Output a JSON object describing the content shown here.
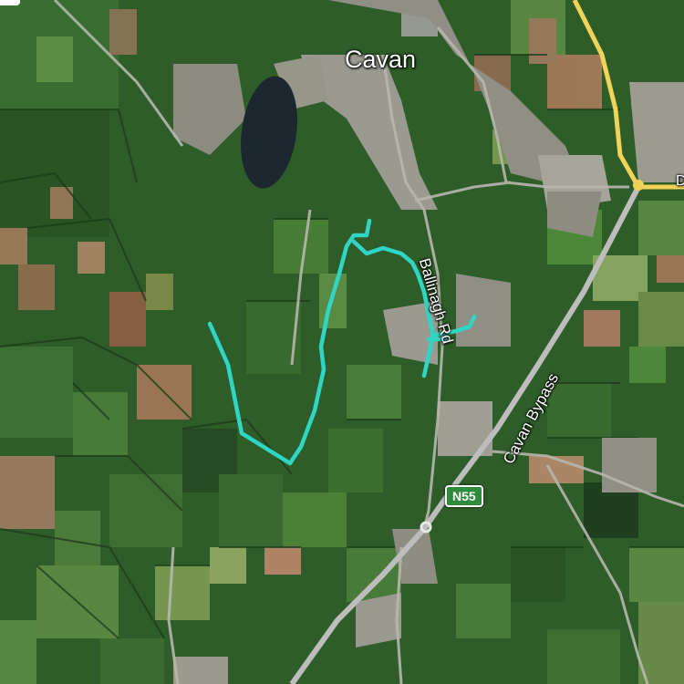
{
  "map": {
    "type": "satellite",
    "labels": {
      "town": "Cavan",
      "road_ballinagh": "Ballinagh Rd",
      "road_bypass": "Cavan Bypass",
      "edge_partial": "D"
    },
    "route_shield": "N55",
    "colors": {
      "trail": "#2fd6c4",
      "motorway": "#f2d35a",
      "road": "#b9b9b9",
      "field_dark": "#234a1f",
      "field_light": "#4f8a3a",
      "lake": "#1e2a33",
      "shield_bg": "#2e8b3b"
    }
  }
}
